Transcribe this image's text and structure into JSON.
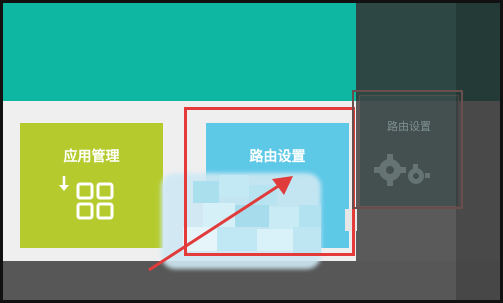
{
  "tiles": {
    "app_management": {
      "label": "应用管理"
    },
    "route_settings": {
      "label": "路由设置"
    },
    "dimmed": {
      "label": "路由设置"
    }
  },
  "icons": {
    "apps": "apps-grid-icon",
    "download": "download-arrow-icon",
    "gear": "gear-icon"
  },
  "colors": {
    "header": "#0db7a1",
    "app_tile": "#b5cb2d",
    "route_tile": "#5ec8e7",
    "highlight": "#e53a3a",
    "arrow": "#e03c3c"
  }
}
